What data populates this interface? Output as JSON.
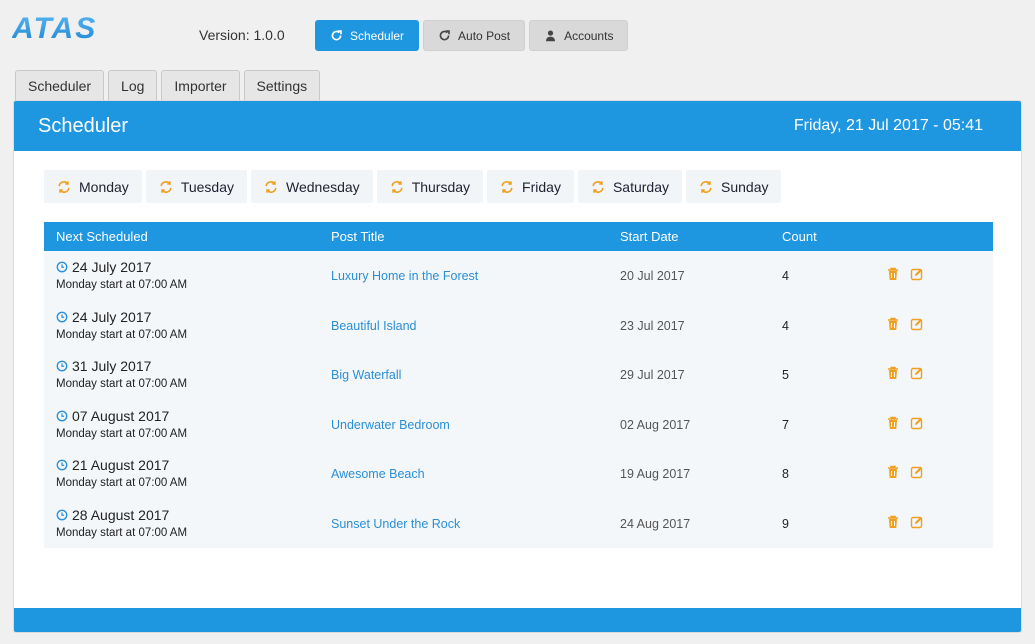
{
  "app": {
    "logo": "ATAS",
    "version": "Version: 1.0.0"
  },
  "topnav": [
    {
      "label": "Scheduler",
      "icon": "refresh-icon",
      "active": true
    },
    {
      "label": "Auto Post",
      "icon": "refresh-icon",
      "active": false
    },
    {
      "label": "Accounts",
      "icon": "user-icon",
      "active": false
    }
  ],
  "tabs": [
    "Scheduler",
    "Log",
    "Importer",
    "Settings"
  ],
  "panel": {
    "title": "Scheduler",
    "datetime": "Friday, 21 Jul 2017 - 05:41"
  },
  "days": [
    "Monday",
    "Tuesday",
    "Wednesday",
    "Thursday",
    "Friday",
    "Saturday",
    "Sunday"
  ],
  "table": {
    "headers": {
      "next": "Next Scheduled",
      "title": "Post Title",
      "start": "Start Date",
      "count": "Count"
    },
    "rows": [
      {
        "next_date": "24 July 2017",
        "next_sub": "Monday start at 07:00 AM",
        "title": "Luxury Home in the Forest",
        "start": "20 Jul 2017",
        "count": "4"
      },
      {
        "next_date": "24 July 2017",
        "next_sub": "Monday start at 07:00 AM",
        "title": "Beautiful Island",
        "start": "23 Jul 2017",
        "count": "4"
      },
      {
        "next_date": "31 July 2017",
        "next_sub": "Monday start at 07:00 AM",
        "title": "Big Waterfall",
        "start": "29 Jul 2017",
        "count": "5"
      },
      {
        "next_date": "07 August 2017",
        "next_sub": "Monday start at 07:00 AM",
        "title": "Underwater Bedroom",
        "start": "02 Aug 2017",
        "count": "7"
      },
      {
        "next_date": "21 August 2017",
        "next_sub": "Monday start at 07:00 AM",
        "title": "Awesome Beach",
        "start": "19 Aug 2017",
        "count": "8"
      },
      {
        "next_date": "28 August 2017",
        "next_sub": "Monday start at 07:00 AM",
        "title": "Sunset Under the Rock",
        "start": "24 Aug 2017",
        "count": "9"
      }
    ]
  },
  "colors": {
    "primary": "#1e96e0",
    "accent": "#f0a020",
    "link": "#2a8fd6"
  }
}
